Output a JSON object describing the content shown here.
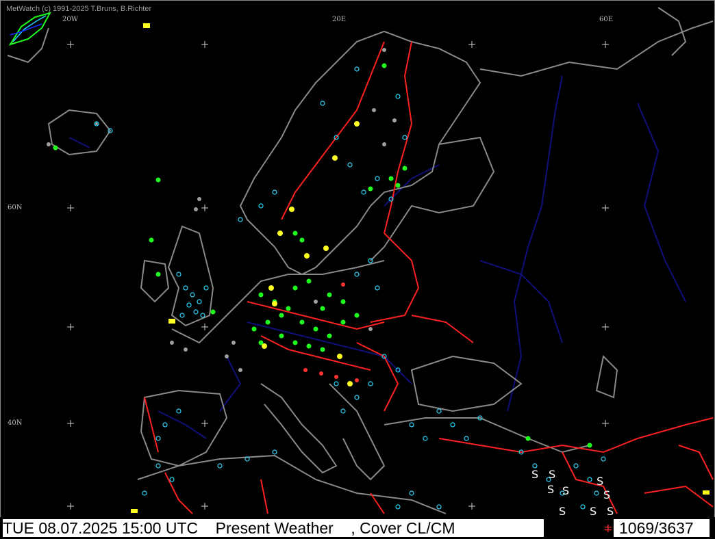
{
  "app": {
    "credit": "MetWatch  (c) 1991-2025 T.Bruns, B.Richter"
  },
  "grid_labels": {
    "lon_20w": "20W",
    "lon_20e": "20E",
    "lon_60e": "60E",
    "lat_60n": "60N",
    "lat_40n": "40N"
  },
  "status": {
    "datetime": "TUE 08.07.2025 15:00 UTC",
    "product": "Present Weather",
    "overlay": ", Cover CL/CM",
    "count": "1069/3637"
  },
  "colors": {
    "coastline": "#8a8a8a",
    "borders": "#ff2020",
    "rivers": "#10107a",
    "cover_symbol": "#28d8ff",
    "rain": "#20ff20",
    "thunder": "#ffff20",
    "haze": "#a0a0a0",
    "sand": "#ffffff"
  },
  "icons": [
    "metwatch-logo-icon",
    "thunder-shower-symbol",
    "sandstorm-symbol",
    "fog-symbol",
    "rain-symbol",
    "station-cover-circle"
  ]
}
